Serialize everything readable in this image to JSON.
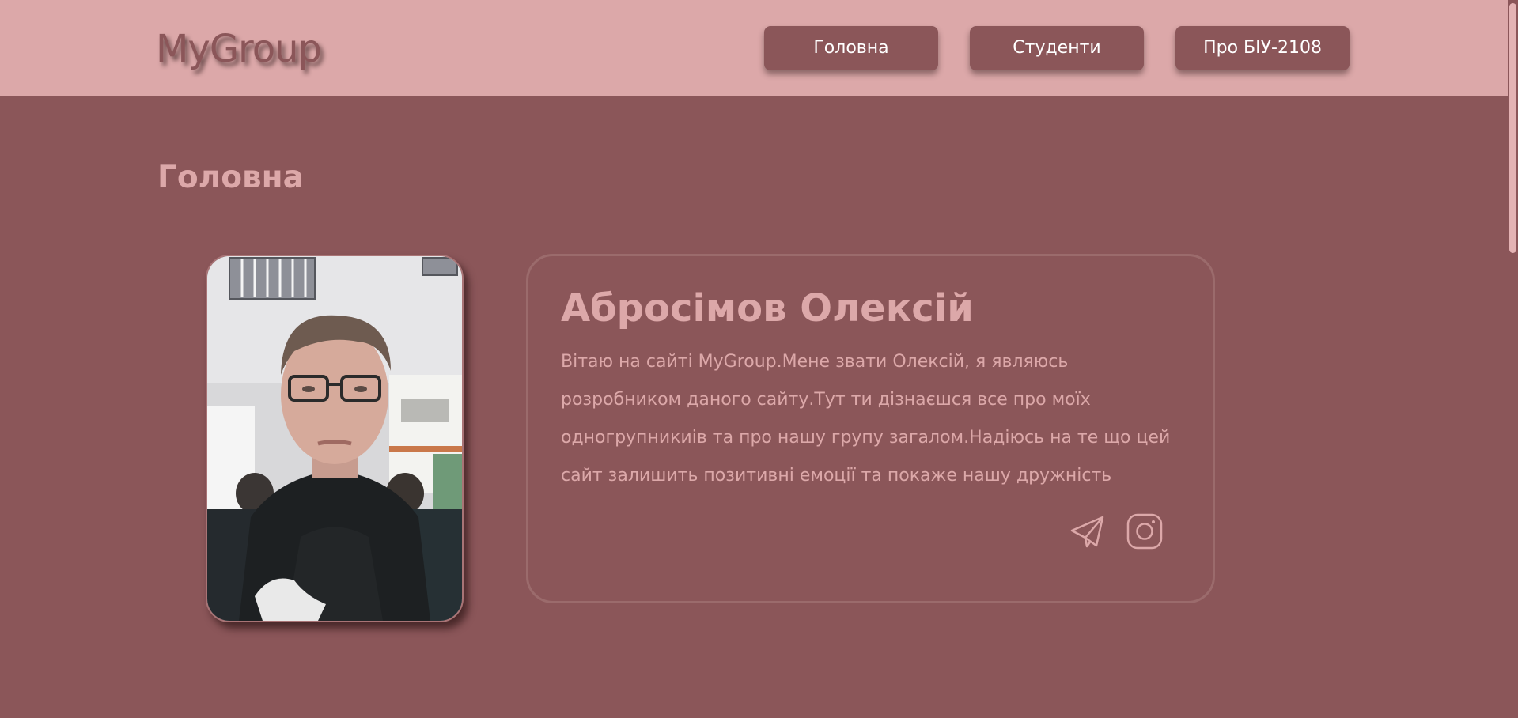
{
  "header": {
    "logo": "MyGroup",
    "nav": [
      {
        "label": "Головна"
      },
      {
        "label": "Студенти"
      },
      {
        "label": "Про БІУ-2108"
      }
    ]
  },
  "main": {
    "title": "Головна",
    "profile": {
      "name": "Абросімов Олексій",
      "bio": "Вітаю на сайті MyGroup.Мене звати Олексій, я являюсь розробником даного сайту.Тут ти дізнаєшся все про моїх одногрупникиів та про нашу групу загалом.Надіюсь на те що цей сайт залишить позитивні емоції та покаже нашу дружність",
      "socials": [
        {
          "icon": "telegram-icon"
        },
        {
          "icon": "instagram-icon"
        }
      ]
    }
  },
  "colors": {
    "background": "#8b5659",
    "header": "#dca8a9",
    "accent_text": "#dca8a9",
    "button": "#8b5659",
    "button_text": "#ffffff"
  }
}
